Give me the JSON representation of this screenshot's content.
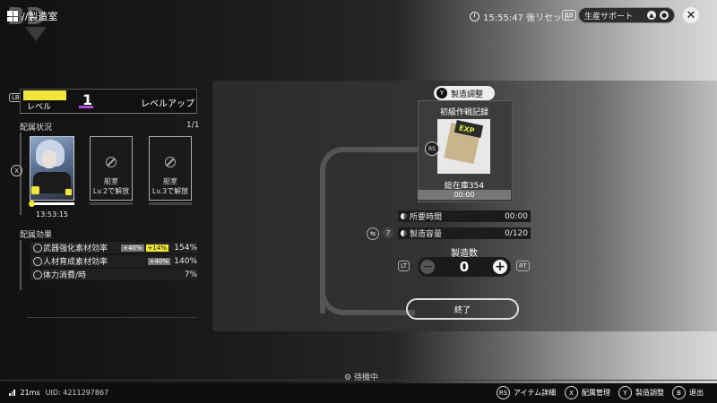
{
  "header": {
    "logo_text": "BD",
    "breadcrumb": "//製造室",
    "reset_text": "15:55:47 後リセット",
    "rb_key": "RB",
    "support_label": "生産サポート"
  },
  "left_panel": {
    "lb_key": "LB",
    "level_label": "レベル",
    "level_value": "1",
    "level_up_label": "レベルアップ",
    "assignment_title": "配属状況",
    "assignment_count": "1/1",
    "assign_key": "X",
    "cards": [
      {
        "time": "13:53:15"
      },
      {
        "name": "船室",
        "unlock": "Lv.2で解放"
      },
      {
        "name": "船室",
        "unlock": "Lv.3で解放"
      }
    ],
    "effects_title": "配属効果",
    "effects": [
      {
        "label": "武器強化素材効率",
        "tag1": "+40%",
        "tag2": "+14%",
        "value": "154%"
      },
      {
        "label": "人材育成素材効率",
        "tag1": "+40%",
        "value": "140%"
      },
      {
        "label": "体力消費/時",
        "value": "7%"
      }
    ]
  },
  "main": {
    "adjust_key": "Y",
    "adjust_label": "製造調整",
    "item_name": "初級作戦記録",
    "item_art_label": "EXP",
    "rs_key": "RS",
    "stock": "総在庫354",
    "item_time": "00:00",
    "stats": [
      {
        "label": "所要時間",
        "value": "00:00"
      },
      {
        "label": "製造容量",
        "value": "0/120"
      }
    ],
    "help_key": "?",
    "qty_label": "製造数",
    "lt_key": "LT",
    "rt_key": "RT",
    "qty_value": "0",
    "end_label": "終了"
  },
  "status": {
    "waiting": "待機中"
  },
  "footer": {
    "ping": "21ms",
    "uid": "UID: 4211297867",
    "hints": [
      {
        "key": "RS",
        "label": "アイテム詳細"
      },
      {
        "key": "X",
        "label": "配属管理"
      },
      {
        "key": "Y",
        "label": "製造調整"
      },
      {
        "key": "B",
        "label": "退出"
      }
    ]
  }
}
